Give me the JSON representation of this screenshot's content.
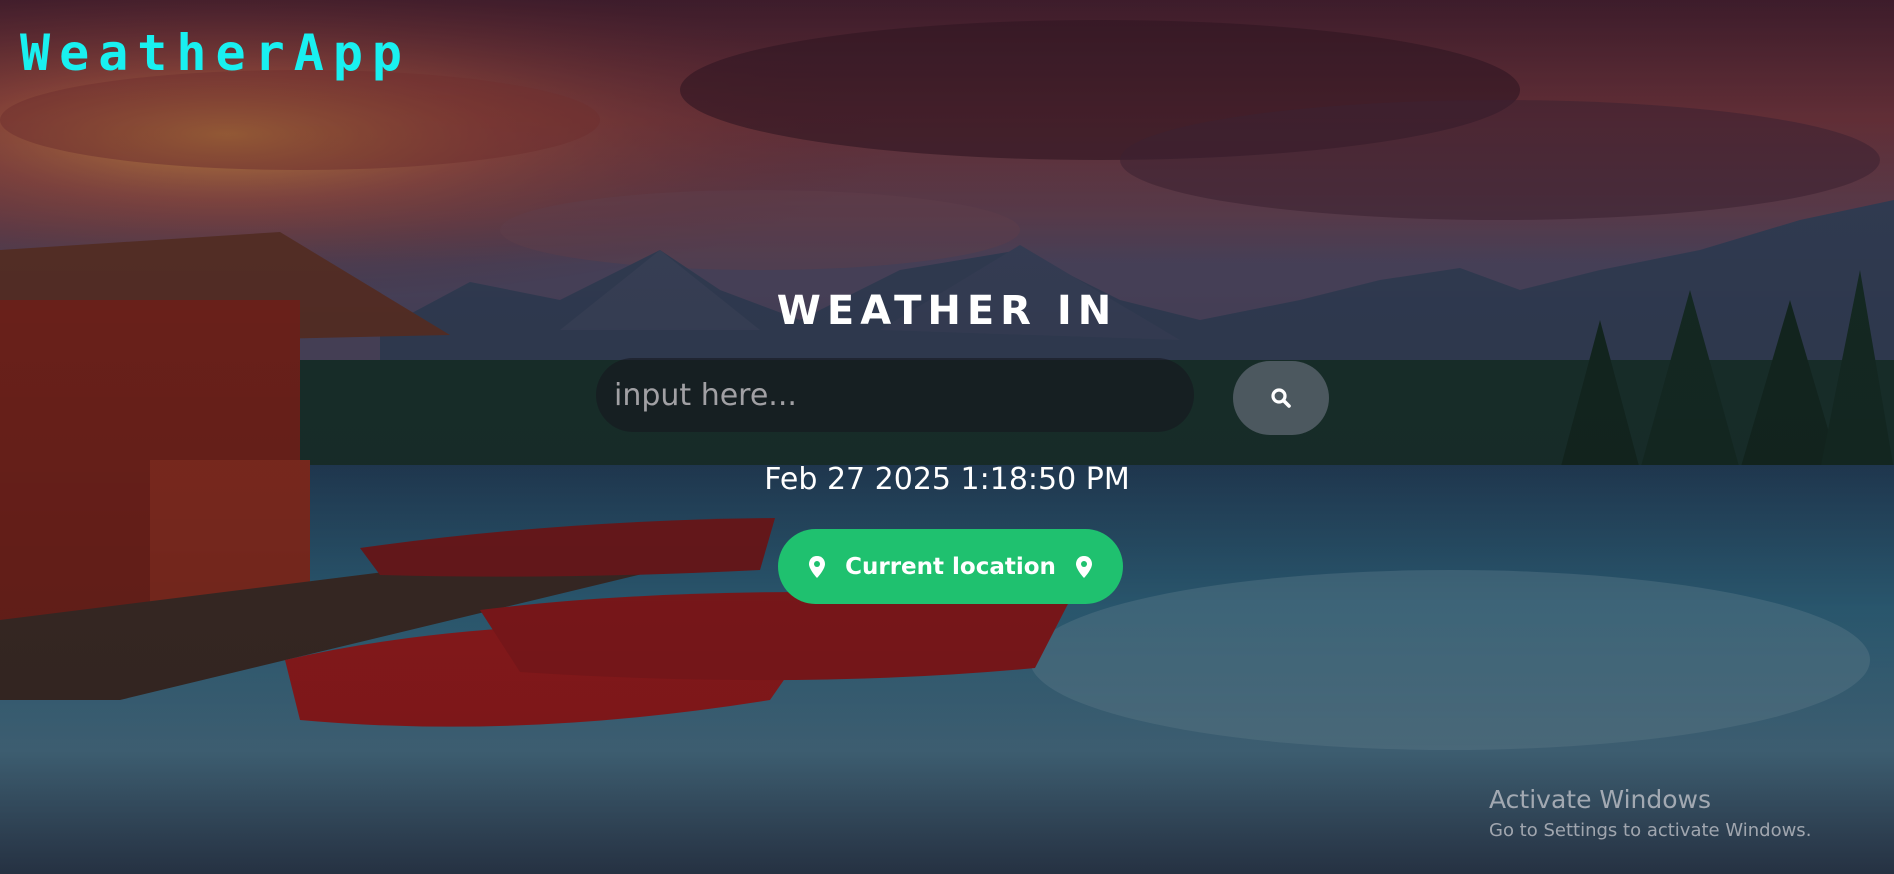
{
  "app": {
    "title": "WeatherApp"
  },
  "search": {
    "heading": "WEATHER IN",
    "placeholder": "input here...",
    "value": ""
  },
  "datetime": {
    "text": "Feb 27 2025 1:18:50 PM"
  },
  "location_button": {
    "label": "Current location"
  },
  "watermark": {
    "title": "Activate Windows",
    "subtitle": "Go to Settings to activate Windows."
  },
  "icons": {
    "search": "search-icon",
    "location": "map-pin-icon"
  },
  "colors": {
    "brand": "#19f0f0",
    "location_button": "#1fc16f",
    "heading": "#ffffff"
  }
}
